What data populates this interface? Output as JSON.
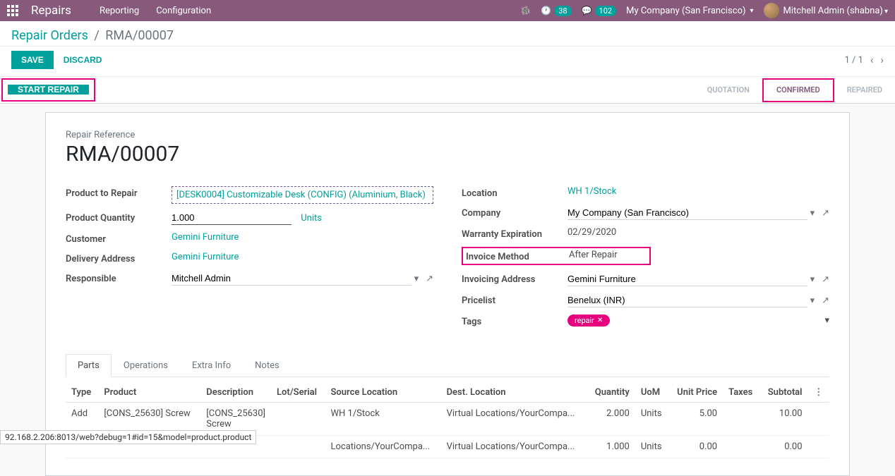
{
  "topbar": {
    "brand": "Repairs",
    "menu": [
      "Reporting",
      "Configuration"
    ],
    "clock_count": "38",
    "chat_count": "102",
    "company": "My Company (San Francisco)",
    "user": "Mitchell Admin (shabna)"
  },
  "breadcrumb": {
    "parent": "Repair Orders",
    "current": "RMA/00007"
  },
  "actions": {
    "save": "SAVE",
    "discard": "DISCARD",
    "pager": "1 / 1",
    "start_repair": "START REPAIR"
  },
  "status_steps": {
    "quotation": "QUOTATION",
    "confirmed": "CONFIRMED",
    "repaired": "REPAIRED"
  },
  "form": {
    "ref_label": "Repair Reference",
    "ref_value": "RMA/00007",
    "left": {
      "product_to_repair_label": "Product to Repair",
      "product_to_repair_value": "[DESK0004] Customizable Desk (CONFIG) (Aluminium, Black)",
      "product_qty_label": "Product Quantity",
      "product_qty_value": "1.000",
      "product_qty_uom": "Units",
      "customer_label": "Customer",
      "customer_value": "Gemini Furniture",
      "delivery_label": "Delivery Address",
      "delivery_value": "Gemini Furniture",
      "responsible_label": "Responsible",
      "responsible_value": "Mitchell Admin"
    },
    "right": {
      "location_label": "Location",
      "location_value": "WH 1/Stock",
      "company_label": "Company",
      "company_value": "My Company (San Francisco)",
      "warranty_label": "Warranty Expiration",
      "warranty_value": "02/29/2020",
      "invoice_method_label": "Invoice Method",
      "invoice_method_value": "After Repair",
      "invoicing_addr_label": "Invoicing Address",
      "invoicing_addr_value": "Gemini Furniture",
      "pricelist_label": "Pricelist",
      "pricelist_value": "Benelux (INR)",
      "tags_label": "Tags",
      "tags_value": "repair"
    }
  },
  "tabs": {
    "parts": "Parts",
    "operations": "Operations",
    "extra": "Extra Info",
    "notes": "Notes"
  },
  "table": {
    "headers": {
      "type": "Type",
      "product": "Product",
      "description": "Description",
      "lot": "Lot/Serial",
      "src": "Source Location",
      "dest": "Dest. Location",
      "qty": "Quantity",
      "uom": "UoM",
      "price": "Unit Price",
      "taxes": "Taxes",
      "subtotal": "Subtotal"
    },
    "rows": [
      {
        "type": "Add",
        "product": "[CONS_25630] Screw",
        "description": "[CONS_25630] Screw",
        "lot": "",
        "src": "WH 1/Stock",
        "dest": "Virtual Locations/YourCompa...",
        "qty": "2.000",
        "uom": "Units",
        "price": "5.00",
        "taxes": "",
        "subtotal": "10.00"
      },
      {
        "type": "",
        "product": "",
        "description": "",
        "lot": "",
        "src": "Locations/YourCompa...",
        "dest": "Virtual Locations/YourCompa...",
        "qty": "1.000",
        "uom": "Units",
        "price": "0.00",
        "taxes": "",
        "subtotal": "0.00"
      }
    ]
  },
  "url_hint": "92.168.2.206:8013/web?debug=1#id=15&model=product.product"
}
